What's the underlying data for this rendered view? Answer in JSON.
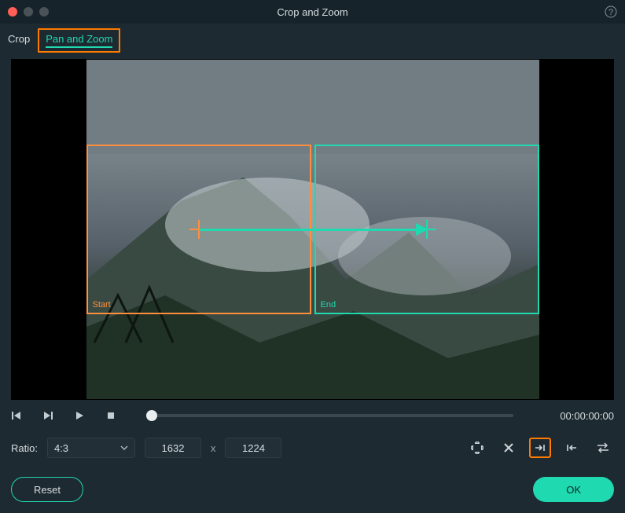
{
  "window": {
    "title": "Crop and Zoom"
  },
  "tabs": {
    "crop": "Crop",
    "pan_zoom": "Pan and Zoom"
  },
  "frames": {
    "start_label": "Start",
    "end_label": "End"
  },
  "transport": {
    "timecode": "00:00:00:00"
  },
  "ratio": {
    "label": "Ratio:",
    "selected": "4:3",
    "width": "1632",
    "sep": "x",
    "height": "1224"
  },
  "buttons": {
    "reset": "Reset",
    "ok": "OK"
  },
  "icons": {
    "help": "help-icon",
    "step_back": "step-back-icon",
    "step_fwd": "step-forward-icon",
    "play": "play-icon",
    "stop": "stop-icon",
    "chevron": "chevron-down-icon",
    "fit": "fit-screen-icon",
    "close_end": "clear-end-icon",
    "go_end": "go-to-end-icon",
    "go_start": "go-to-start-icon",
    "swap": "swap-icon"
  }
}
